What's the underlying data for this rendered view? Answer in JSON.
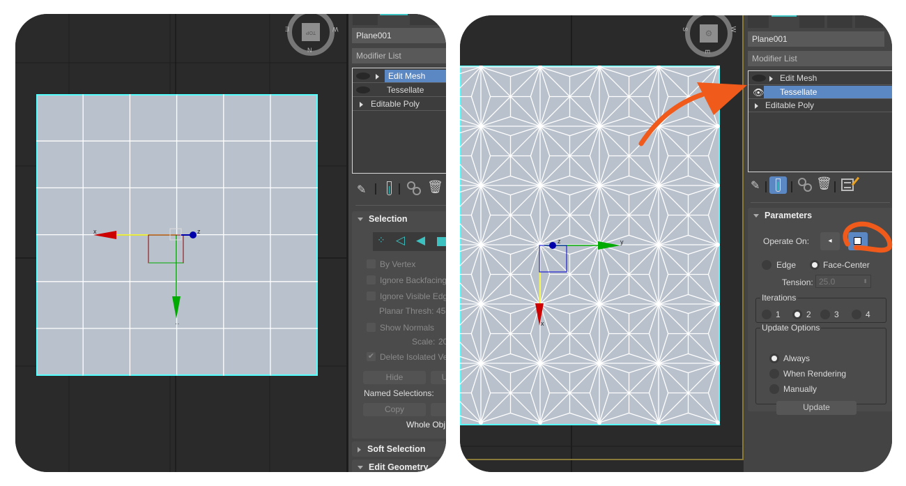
{
  "left": {
    "viewcube": {
      "face_label": "TOP",
      "compass": [
        "N",
        "E",
        "W"
      ]
    },
    "gizmo": {
      "x_label": "x",
      "y_label": "y",
      "z_label": "z"
    },
    "object_name": "Plane001",
    "modifier_list": "Modifier List",
    "stack": [
      {
        "label": "Edit Mesh",
        "selected": true
      },
      {
        "label": "Tessellate",
        "selected": false
      },
      {
        "label": "Editable Poly",
        "selected": false
      }
    ],
    "selection": {
      "title": "Selection",
      "by_vertex": "By Vertex",
      "ignore_backfacing": "Ignore Backfacing",
      "ignore_visible_edges": "Ignore Visible Edg",
      "planar_thresh_label": "Planar Thresh:",
      "planar_thresh_value": "45",
      "show_normals": "Show Normals",
      "scale_label": "Scale:",
      "scale_value": "20",
      "delete_isolated": "Delete Isolated Ve",
      "hide_button": "Hide",
      "unhide_button": "U",
      "named_selections": "Named Selections:",
      "copy_button": "Copy",
      "whole_object": "Whole Obj"
    },
    "soft_selection": "Soft Selection",
    "edit_geometry": "Edit Geometry"
  },
  "right": {
    "viewcube": {
      "compass": [
        "S",
        "E",
        "W"
      ]
    },
    "gizmo": {
      "x_label": "x",
      "y_label": "y",
      "z_label": "z"
    },
    "object_name": "Plane001",
    "modifier_list": "Modifier List",
    "stack": [
      {
        "label": "Edit Mesh",
        "selected": false
      },
      {
        "label": "Tessellate",
        "selected": true
      },
      {
        "label": "Editable Poly",
        "selected": false
      }
    ],
    "parameters": {
      "title": "Parameters",
      "operate_on": "Operate On:",
      "edge": "Edge",
      "face_center": "Face-Center",
      "tension_label": "Tension:",
      "tension_value": "25.0",
      "iterations_title": "Iterations",
      "iterations": [
        "1",
        "2",
        "3",
        "4"
      ],
      "iterations_selected": "2",
      "update_title": "Update Options",
      "always": "Always",
      "when_rendering": "When Rendering",
      "manually": "Manually",
      "update_button": "Update"
    }
  },
  "colors": {
    "selection_blue": "#5b87c3",
    "annotation_orange": "#f05a1a",
    "mesh": "#b9c1cc",
    "teal_icon": "#3cc0c0"
  }
}
